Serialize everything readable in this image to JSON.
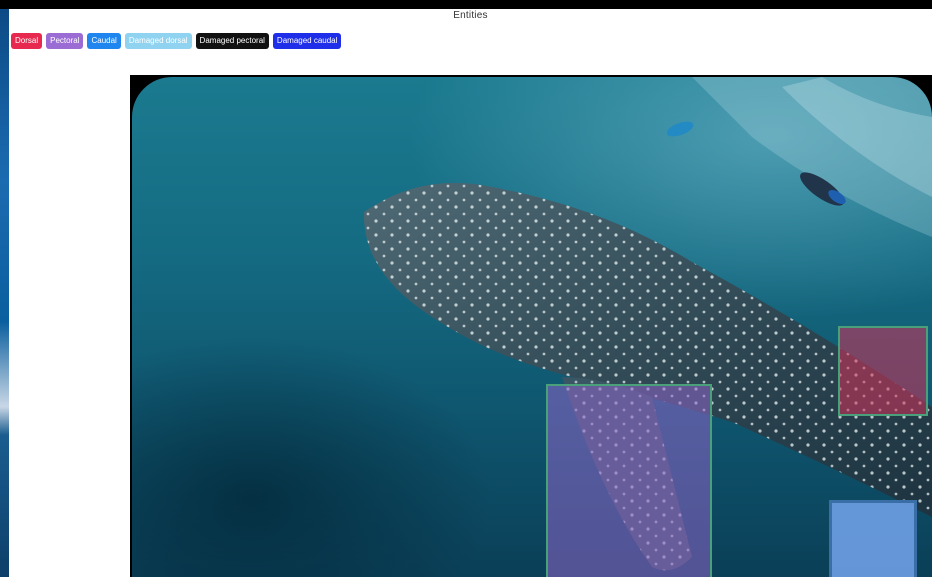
{
  "panel": {
    "title": "Entities"
  },
  "tags": [
    {
      "label": "Dorsal",
      "color": "#e8294f"
    },
    {
      "label": "Pectoral",
      "color": "#9b6dd4"
    },
    {
      "label": "Caudal",
      "color": "#1f86f0"
    },
    {
      "label": "Damaged dorsal",
      "color": "#8fd3f0"
    },
    {
      "label": "Damaged pectoral",
      "color": "#111111"
    },
    {
      "label": "Damaged caudal",
      "color": "#1f2ee8"
    }
  ],
  "annotations": {
    "pectoral_color": "#8e64c8",
    "dorsal_color": "#d4325a",
    "caudal_color": "#6ea0e6",
    "box_border": "#4aa07a"
  }
}
